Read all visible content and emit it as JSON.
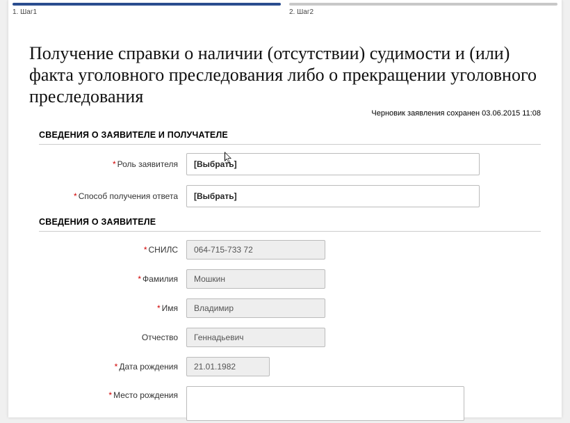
{
  "stepper": {
    "step1": "1. Шаг1",
    "step2": "2. Шаг2"
  },
  "title": "Получение справки о наличии (отсутствии) судимости и (или) факта уголовного преследования либо о прекращении уголовного преследования",
  "draft_saved": "Черновик заявления сохранен 03.06.2015 11:08",
  "section1": {
    "header": "СВЕДЕНИЯ О ЗАЯВИТЕЛЕ И ПОЛУЧАТЕЛЕ",
    "role_label": "Роль заявителя",
    "role_value": "[Выбрать]",
    "reply_method_label": "Способ получения ответа",
    "reply_method_value": "[Выбрать]"
  },
  "section2": {
    "header": "СВЕДЕНИЯ О ЗАЯВИТЕЛЕ",
    "snils_label": "СНИЛС",
    "snils_value": "064-715-733 72",
    "lastname_label": "Фамилия",
    "lastname_value": "Мошкин",
    "firstname_label": "Имя",
    "firstname_value": "Владимир",
    "patronymic_label": "Отчество",
    "patronymic_value": "Геннадьевич",
    "dob_label": "Дата рождения",
    "dob_value": "21.01.1982",
    "birthplace_label": "Место рождения",
    "birthplace_value": ""
  }
}
